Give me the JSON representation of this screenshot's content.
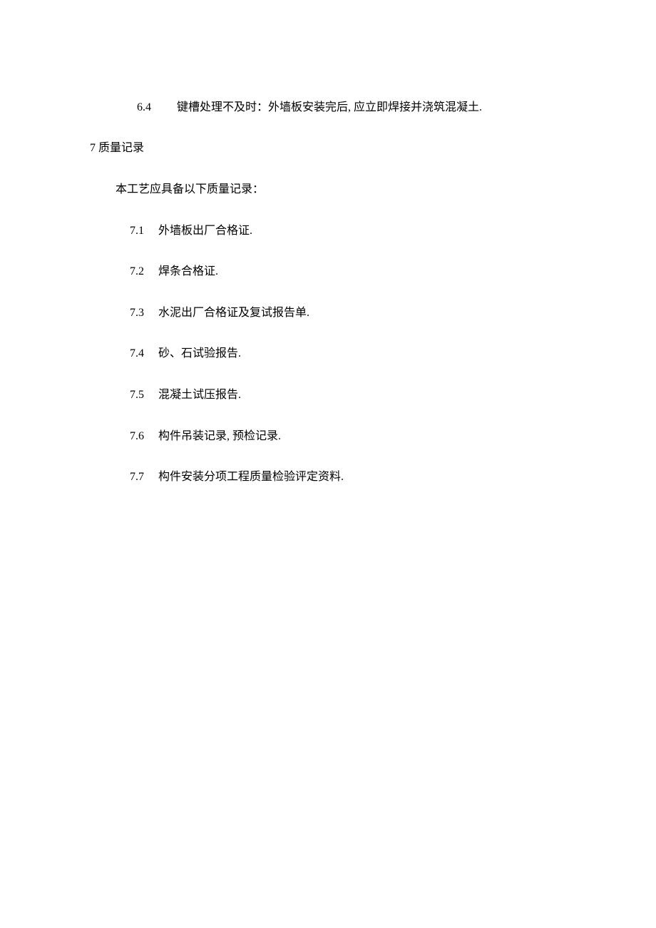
{
  "line_6_4": {
    "num": "6.4",
    "text": "键槽处理不及时：外墙板安装完后, 应立即焊接并浇筑混凝土."
  },
  "section_7": {
    "num": "7",
    "title": " 质量记录"
  },
  "intro": "本工艺应具备以下质量记录：",
  "items": [
    {
      "num": "7.1",
      "text": "外墙板出厂合格证."
    },
    {
      "num": "7.2",
      "text": "焊条合格证."
    },
    {
      "num": "7.3",
      "text": "水泥出厂合格证及复试报告单."
    },
    {
      "num": "7.4",
      "text": "砂、石试验报告."
    },
    {
      "num": "7.5",
      "text": "混凝土试压报告."
    },
    {
      "num": "7.6",
      "text": "构件吊装记录, 预检记录."
    },
    {
      "num": "7.7",
      "text": "构件安装分项工程质量检验评定资料."
    }
  ]
}
